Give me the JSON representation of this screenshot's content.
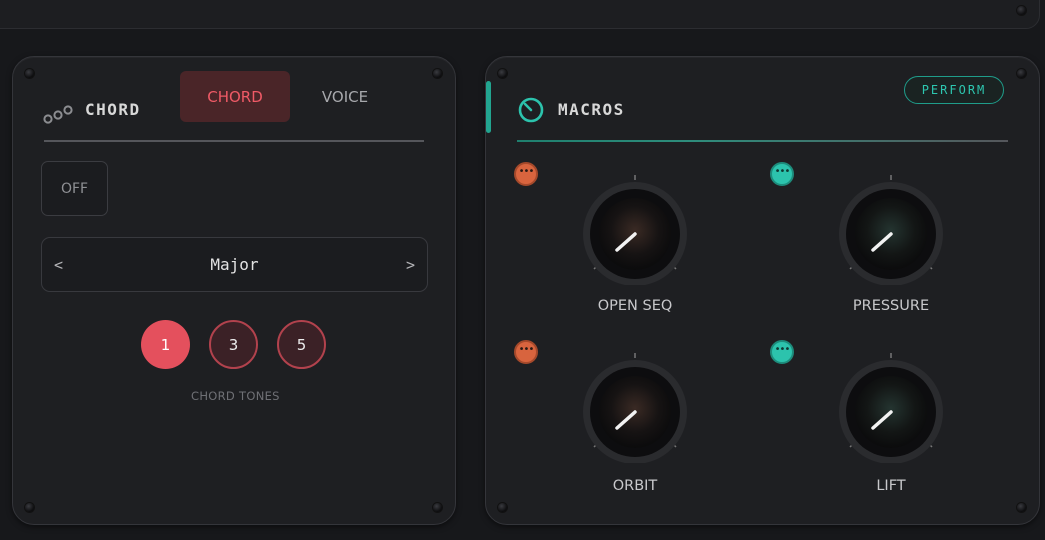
{
  "chord_panel": {
    "title": "CHORD",
    "icon": "chord-dots-icon",
    "tabs": [
      {
        "label": "CHORD",
        "active": true
      },
      {
        "label": "VOICE",
        "active": false
      }
    ],
    "off_button": "OFF",
    "selector": {
      "prev": "<",
      "value": "Major",
      "next": ">"
    },
    "tones": [
      {
        "label": "1",
        "active": true
      },
      {
        "label": "3",
        "active": false
      },
      {
        "label": "5",
        "active": false
      }
    ],
    "tones_caption": "CHORD TONES",
    "accent_color": "#e4505d"
  },
  "macros_panel": {
    "title": "MACROS",
    "icon": "knob-icon",
    "perform_button": "PERFORM",
    "accent_color": "#2cc3ad",
    "macros": [
      {
        "label": "OPEN SEQ",
        "mod_color": "orange",
        "mod_dots": "•••"
      },
      {
        "label": "PRESSURE",
        "mod_color": "teal",
        "mod_dots": "•••"
      },
      {
        "label": "ORBIT",
        "mod_color": "orange",
        "mod_dots": "•••"
      },
      {
        "label": "LIFT",
        "mod_color": "teal",
        "mod_dots": "•••"
      }
    ]
  }
}
